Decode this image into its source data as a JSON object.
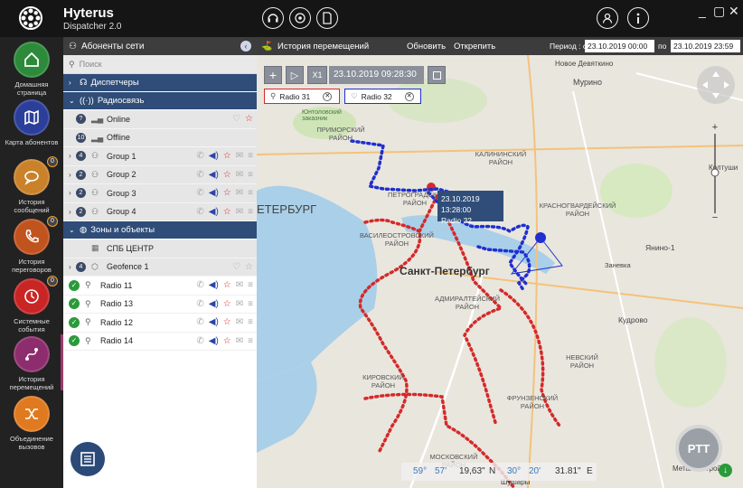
{
  "app": {
    "title": "Hyterus",
    "subtitle": "Dispatcher 2.0"
  },
  "topbar": {
    "icons": [
      "headset-icon",
      "gear-flower-icon",
      "document-icon",
      "user-icon",
      "info-icon"
    ],
    "window_min": "_",
    "window_max": "▢",
    "window_close": "✕"
  },
  "rail": {
    "items": [
      {
        "label": "Домашняя страница",
        "icon": "home-icon",
        "color": "#2c8a3a"
      },
      {
        "label": "Карта абонентов",
        "icon": "map-icon",
        "color": "#2b3f9a"
      },
      {
        "label": "История сообщений",
        "icon": "chat-icon",
        "color": "#c9822a",
        "badge": "0"
      },
      {
        "label": "История переговоров",
        "icon": "phone-icon",
        "color": "#c0531e",
        "badge": "0"
      },
      {
        "label": "Системные события",
        "icon": "clock-icon",
        "color": "#c92525",
        "badge": "0"
      },
      {
        "label": "История перемещений",
        "icon": "route-icon",
        "color": "#8e2d6e"
      },
      {
        "label": "Объединение вызовов",
        "icon": "merge-icon",
        "color": "#e07a20"
      }
    ]
  },
  "panel": {
    "title": "Абоненты сети",
    "collapse": "‹",
    "search_placeholder": "Поиск",
    "groups": {
      "dispatchers": "Диспетчеры",
      "radio": "Радиосвязь",
      "zones": "Зоны и объекты"
    },
    "radio_rows": [
      {
        "badge": "?",
        "label": "Online"
      },
      {
        "badge": "10",
        "label": "Offline"
      },
      {
        "badge": "4",
        "label": "Group 1"
      },
      {
        "badge": "2",
        "label": "Group 2"
      },
      {
        "badge": "2",
        "label": "Group 3"
      },
      {
        "badge": "2",
        "label": "Group 4"
      }
    ],
    "zone_rows": [
      {
        "label": "СПБ ЦЕНТР"
      },
      {
        "badge": "4",
        "label": "Geofence 1"
      }
    ],
    "radios": [
      {
        "label": "Radio 11"
      },
      {
        "label": "Radio 13"
      },
      {
        "label": "Radio 12"
      },
      {
        "label": "Radio 14"
      }
    ]
  },
  "history": {
    "title": "История перемещений",
    "refresh": "Обновить",
    "open": "Открепить",
    "period_label": "Период : с",
    "from": "23.10.2019 00:00",
    "to_label": "по",
    "to": "23.10.2019 23:59",
    "playback_time": "23.10.2019 09:28:30",
    "speed": "X1",
    "chips": [
      "Radio 31",
      "Radio 32"
    ],
    "tooltip_time": "23.10.2019 13:28:00",
    "tooltip_name": "Radio 32"
  },
  "map_labels": [
    "ПРИМОРСКИЙ РАЙОН",
    "КАЛИНИНСКИЙ РАЙОН",
    "ПЕТРОГРАДСКИЙ РАЙОН",
    "КРАСНОГВАРДЕЙСКИЙ РАЙОН",
    "ВАСИЛЕОСТРОВСКИЙ РАЙОН",
    "Санкт-Петербург",
    "АДМИРАЛТЕЙСКИЙ РАЙОН",
    "КИРОВСКИЙ РАЙОН",
    "ФРУНЗЕНСКИЙ РАЙОН",
    "НЕВСКИЙ РАЙОН",
    "МОСКОВСКИЙ РАЙОН",
    "Новое Девяткино",
    "Мурино",
    "Кудрово",
    "Янино-1",
    "Заневка",
    "Юнтоловский заказник",
    "Шушары",
    "Металлострой",
    "ЕТЕРБУРГ",
    "Колтуши"
  ],
  "coords": {
    "lat_deg": "59°",
    "lat_min": "57'",
    "lat_sec": "19,63\"",
    "lat_dir": "N",
    "lon_deg": "30°",
    "lon_min": "20'",
    "lon_sec": "31.81\"",
    "lon_dir": "E"
  },
  "ptt_label": "PTT",
  "colors": {
    "track_red": "#d42a2a",
    "track_blue": "#1f2fd0",
    "accent": "#2f4d78"
  }
}
